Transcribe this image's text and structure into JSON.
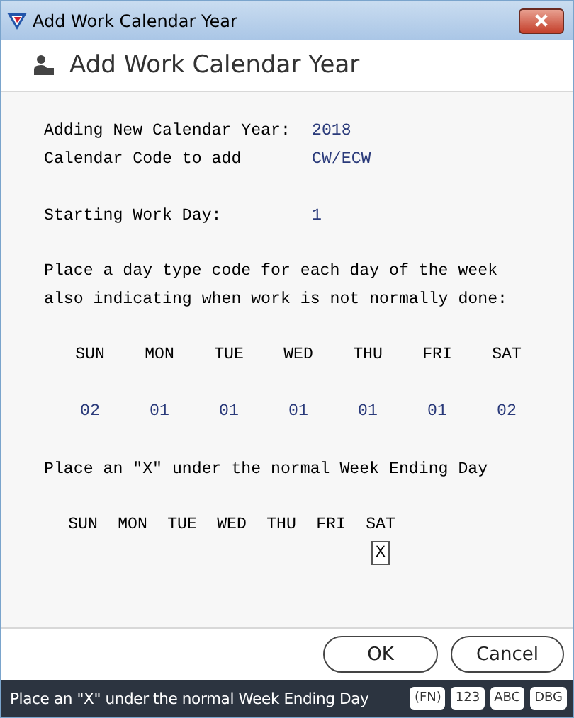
{
  "window": {
    "title": "Add Work Calendar Year"
  },
  "header": {
    "title": "Add Work Calendar Year"
  },
  "fields": [
    {
      "label": "Adding New Calendar Year:",
      "value": "2018"
    },
    {
      "label": "Calendar Code to add",
      "value": "CW/ECW"
    },
    {
      "label": "Starting Work Day:",
      "value": "1"
    }
  ],
  "day_type_instructions": "Place a day type code for each day of the week\nalso indicating when work is not normally done:",
  "day_types": [
    {
      "day": "SUN",
      "code": "02"
    },
    {
      "day": "MON",
      "code": "01"
    },
    {
      "day": "TUE",
      "code": "01"
    },
    {
      "day": "WED",
      "code": "01"
    },
    {
      "day": "THU",
      "code": "01"
    },
    {
      "day": "FRI",
      "code": "01"
    },
    {
      "day": "SAT",
      "code": "02"
    }
  ],
  "week_ending_instructions": "Place an \"X\" under the normal Week Ending Day",
  "week_ending_days": [
    {
      "day": "SUN"
    },
    {
      "day": "MON"
    },
    {
      "day": "TUE"
    },
    {
      "day": "WED"
    },
    {
      "day": "THU"
    },
    {
      "day": "FRI"
    },
    {
      "day": "SAT",
      "value": "X"
    }
  ],
  "buttons": [
    "OK",
    "Cancel"
  ],
  "status_bar": {
    "message": "Place an \"X\" under the normal Week Ending Day",
    "indicators": [
      "(FN)",
      "123",
      "ABC",
      "DBG"
    ]
  }
}
